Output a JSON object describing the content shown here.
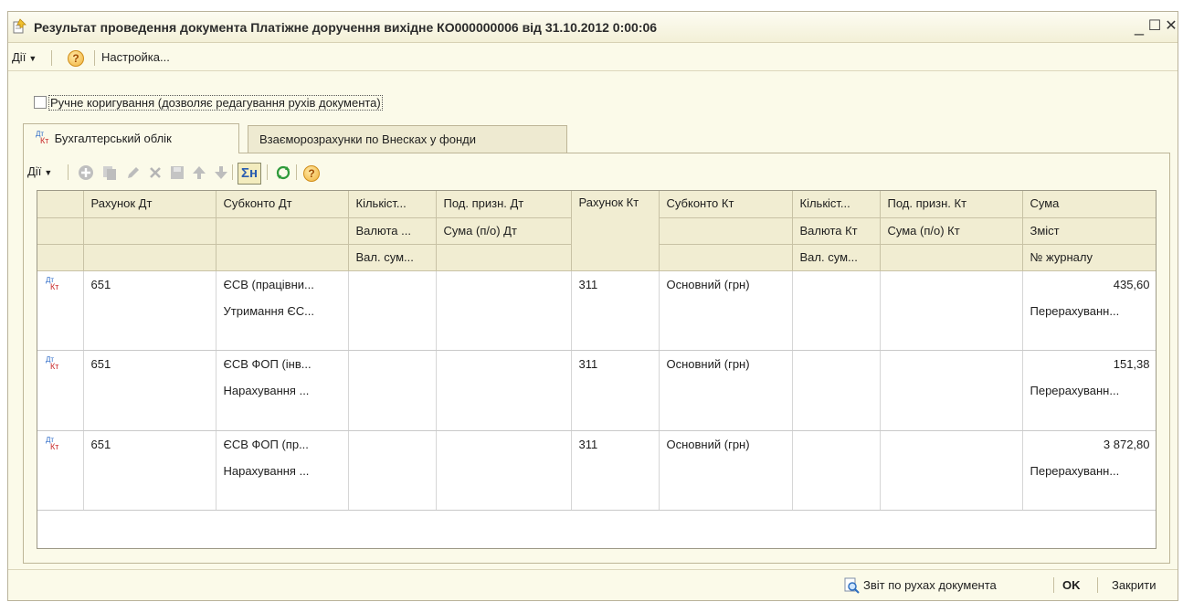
{
  "window": {
    "title": "Результат проведення документа Платіжне доручення вихідне КО000000006 від 31.10.2012 0:00:06",
    "controls": {
      "minimize": "_",
      "maximize": "☐",
      "close": "✕"
    }
  },
  "menubar": {
    "actions": "Дії",
    "help": "?",
    "settings": "Настройка..."
  },
  "manual_edit": {
    "label": "Ручне коригування (дозволяє редагування рухів документа)",
    "checked": false
  },
  "tabs": [
    {
      "label": "Бухгалтерський облік",
      "icon": "dt-kt-icon",
      "active": true
    },
    {
      "label": "Взаєморозрахунки по Внесках у фонди",
      "active": false
    }
  ],
  "toolbar": {
    "actions": "Дії",
    "icons": [
      "add-icon",
      "copy-icon",
      "edit-icon",
      "delete-icon",
      "save-icon",
      "move-up-icon",
      "move-down-icon",
      "totals-icon",
      "refresh-icon",
      "help-icon"
    ],
    "totals_label": "Σн",
    "help": "?"
  },
  "grid": {
    "header": {
      "row1": [
        "",
        "Рахунок Дт",
        "Субконто Дт",
        "Кількіст...",
        "Под. призн. Дт",
        "Рахунок Кт",
        "Субконто Кт",
        "Кількіст...",
        "Под. призн. Кт",
        "Сума"
      ],
      "row2": [
        "",
        "",
        "",
        "Валюта ...",
        "Сума (п/о) Дт",
        "",
        "",
        "Валюта Кт",
        "Сума (п/о) Кт",
        "Зміст"
      ],
      "row3": [
        "",
        "",
        "",
        "Вал. сум...",
        "",
        "",
        "",
        "Вал. сум...",
        "",
        "№ журналу"
      ]
    },
    "records": [
      {
        "icon": "Дт Кт",
        "debit_account": "651",
        "subconto_dt": [
          "ЄСВ (працівни...",
          "Утримання ЄС...",
          ""
        ],
        "credit_account": "311",
        "subconto_kt": "Основний (грн)",
        "amount": "435,60",
        "content": "Перерахуванн..."
      },
      {
        "icon": "Дт Кт",
        "debit_account": "651",
        "subconto_dt": [
          "ЄСВ ФОП (інв...",
          "Нарахування ...",
          ""
        ],
        "credit_account": "311",
        "subconto_kt": "Основний (грн)",
        "amount": "151,38",
        "content": "Перерахуванн..."
      },
      {
        "icon": "Дт Кт",
        "debit_account": "651",
        "subconto_dt": [
          "ЄСВ ФОП (пр...",
          "Нарахування ...",
          ""
        ],
        "credit_account": "311",
        "subconto_kt": "Основний (грн)",
        "amount": "3 872,80",
        "content": "Перерахуванн..."
      }
    ]
  },
  "statusbar": {
    "report": "Звіт по рухах документа",
    "ok": "OK",
    "close": "Закрити"
  }
}
